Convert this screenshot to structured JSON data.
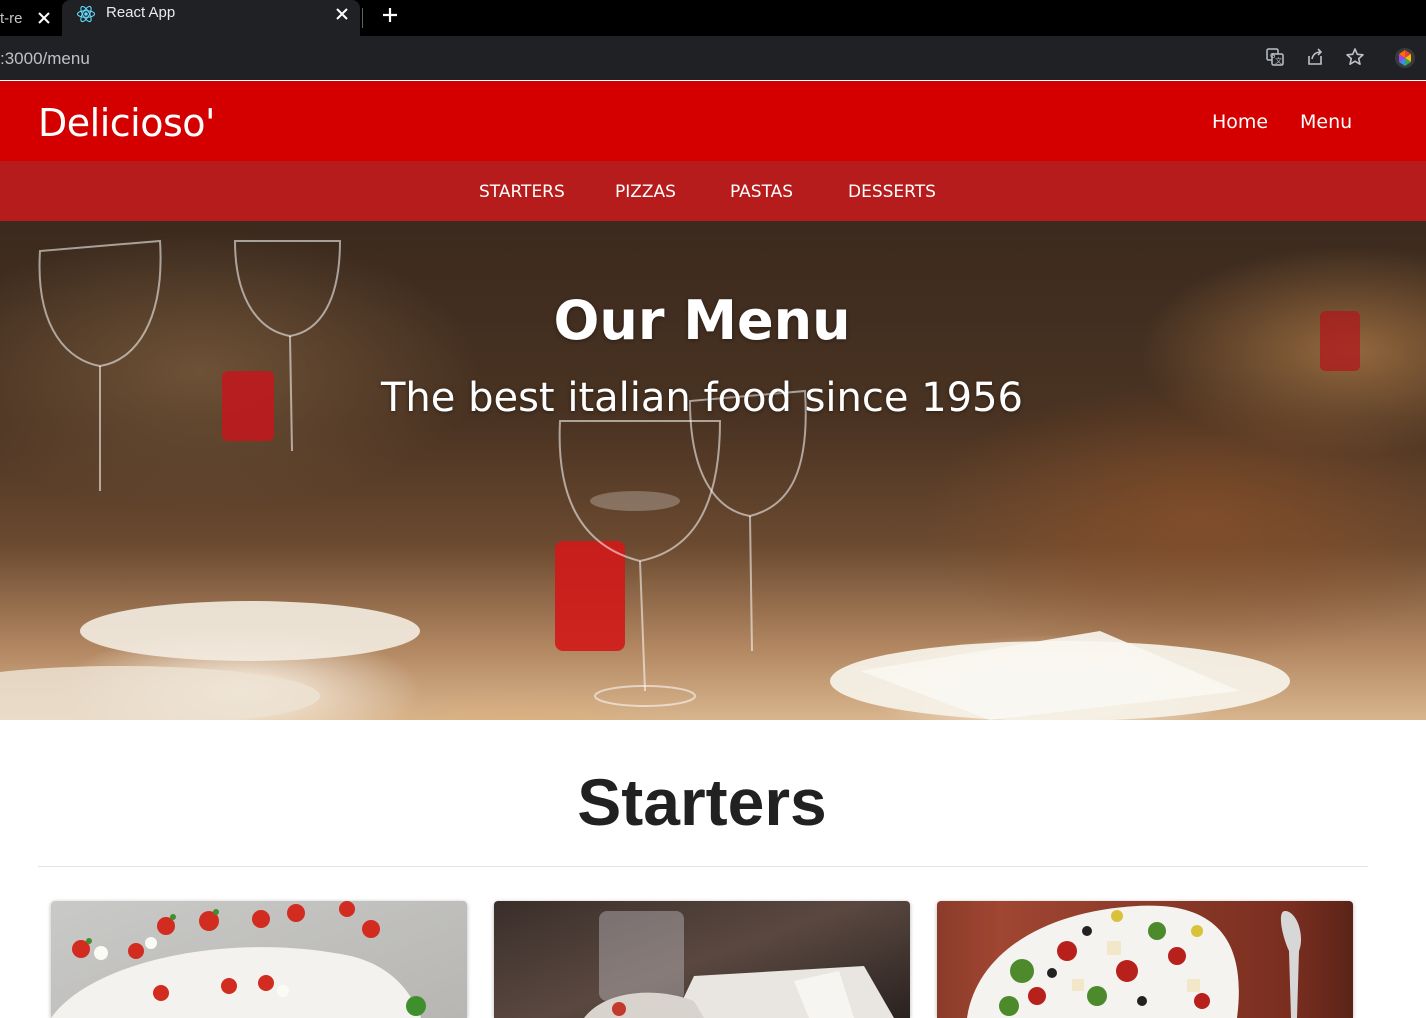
{
  "browser": {
    "prev_tab_title": "t-re",
    "active_tab_title": "React App",
    "url": ":3000/menu",
    "icons": [
      "close-icon",
      "react-icon",
      "plus-icon",
      "translate-icon",
      "share-icon",
      "star-icon",
      "profile-icon"
    ]
  },
  "navbar": {
    "brand": "Delicioso'",
    "links": [
      "Home",
      "Menu"
    ]
  },
  "subnav": {
    "items": [
      "STARTERS",
      "PIZZAS",
      "PASTAS",
      "DESSERTS"
    ]
  },
  "hero": {
    "title": "Our Menu",
    "subtitle": "The best italian food since 1956"
  },
  "section": {
    "title": "Starters"
  },
  "colors": {
    "navbar": "#d40000",
    "subnav": "#b71c1c",
    "chrome_bg": "#202124"
  }
}
